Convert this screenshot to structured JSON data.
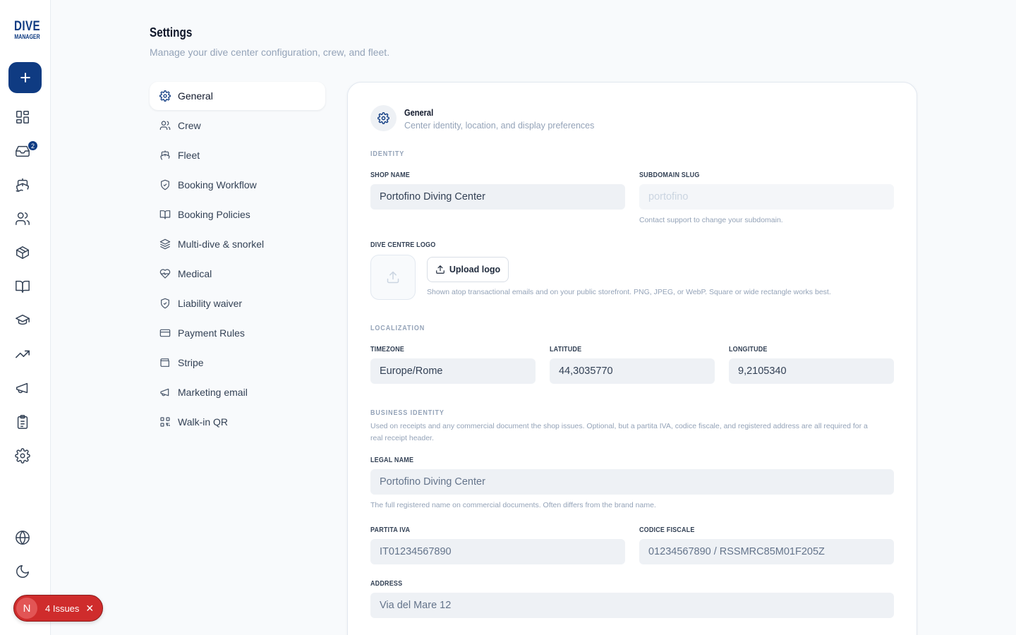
{
  "brand": {
    "line1": "DIVE",
    "line2": "MANAGER",
    "color": "#0f3b82"
  },
  "rail": {
    "add_icon": "plus-icon",
    "inbox_badge": "2",
    "items": [
      "dashboard-icon",
      "inbox-icon",
      "boat-icon",
      "users-icon",
      "box-icon",
      "book-icon",
      "graduation-cap-icon",
      "trending-up-icon",
      "megaphone-icon",
      "clipboard-icon",
      "settings-icon"
    ],
    "bottom": [
      "globe-icon",
      "moon-icon"
    ]
  },
  "issues": {
    "avatar": "N",
    "label": "4 Issues",
    "color": "#cf2c2c"
  },
  "header": {
    "title": "Settings",
    "subtitle": "Manage your dive center configuration, crew, and fleet."
  },
  "settings_nav": {
    "items": [
      {
        "label": "General",
        "icon": "gear-icon",
        "active": true
      },
      {
        "label": "Crew",
        "icon": "users-icon"
      },
      {
        "label": "Fleet",
        "icon": "boat-icon"
      },
      {
        "label": "Booking Workflow",
        "icon": "shield-icon"
      },
      {
        "label": "Booking Policies",
        "icon": "book-icon"
      },
      {
        "label": "Multi-dive & snorkel",
        "icon": "layers-icon"
      },
      {
        "label": "Medical",
        "icon": "heart-pulse-icon"
      },
      {
        "label": "Liability waiver",
        "icon": "shield-check-icon"
      },
      {
        "label": "Payment Rules",
        "icon": "credit-card-icon"
      },
      {
        "label": "Stripe",
        "icon": "wallet-icon"
      },
      {
        "label": "Marketing email",
        "icon": "megaphone-icon"
      },
      {
        "label": "Walk-in QR",
        "icon": "qr-code-icon"
      }
    ]
  },
  "card": {
    "title": "General",
    "subtitle": "Center identity, location, and display preferences",
    "identity": {
      "section": "IDENTITY",
      "shop_name_label": "SHOP NAME",
      "shop_name_value": "Portofino Diving Center",
      "subdomain_label": "SUBDOMAIN SLUG",
      "subdomain_value": "portofino",
      "subdomain_help": "Contact support to change your subdomain.",
      "logo_label": "DIVE CENTRE LOGO",
      "upload_label": "Upload logo",
      "logo_help": "Shown atop transactional emails and on your public storefront. PNG, JPEG, or WebP. Square or wide rectangle works best."
    },
    "localization": {
      "section": "LOCALIZATION",
      "timezone_label": "TIMEZONE",
      "timezone_value": "Europe/Rome",
      "latitude_label": "LATITUDE",
      "latitude_value": "44,3035770",
      "longitude_label": "LONGITUDE",
      "longitude_value": "9,2105340"
    },
    "business": {
      "section": "BUSINESS IDENTITY",
      "help": "Used on receipts and any commercial document the shop issues. Optional, but a partita IVA, codice fiscale, and registered address are all required for a real receipt header.",
      "legal_name_label": "LEGAL NAME",
      "legal_name_value": "Portofino Diving Center",
      "legal_name_help": "The full registered name on commercial documents. Often differs from the brand name.",
      "piva_label": "PARTITA IVA",
      "piva_value": "IT01234567890",
      "cf_label": "CODICE FISCALE",
      "cf_value": "01234567890 / RSSMRC85M01F205Z",
      "address_label": "ADDRESS",
      "address_value": "Via del Mare 12"
    }
  }
}
